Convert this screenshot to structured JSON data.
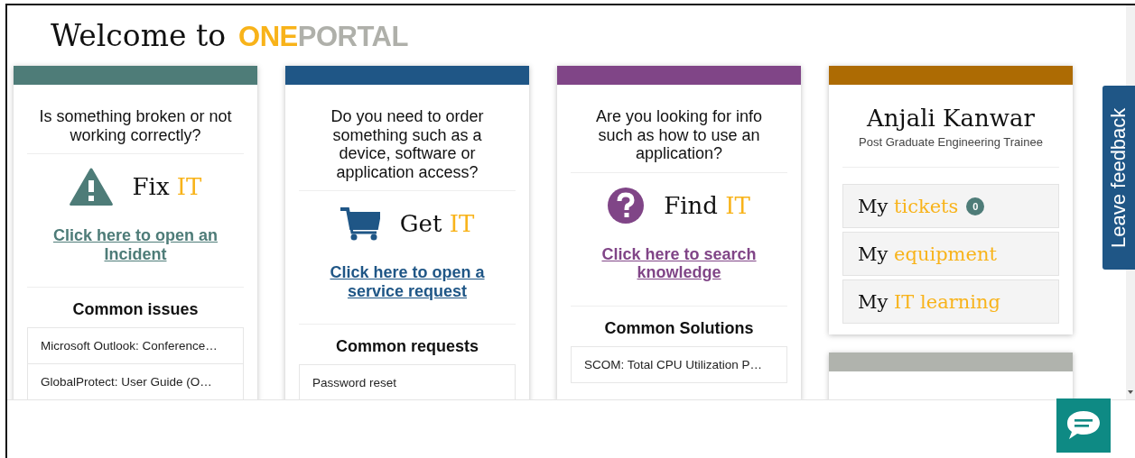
{
  "header": {
    "welcome": "Welcome to",
    "brand_primary": "ONE",
    "brand_secondary": "PORTAL"
  },
  "cards": [
    {
      "kind": "fix",
      "color": "#4e7c78",
      "question": "Is something broken or not working correctly?",
      "title": "Fix",
      "title_accent": "IT",
      "link": "Click here to open an Incident",
      "list_title": "Common issues",
      "items": [
        "Microsoft Outlook: Conference…",
        "GlobalProtect: User Guide (O…"
      ]
    },
    {
      "kind": "get",
      "color": "#1f5686",
      "question": "Do you need to order something such as a device, software or application access?",
      "title": "Get",
      "title_accent": "IT",
      "link": "Click here to open a service request",
      "list_title": "Common requests",
      "items": [
        "Password reset"
      ]
    },
    {
      "kind": "find",
      "color": "#804587",
      "question": "Are you looking for info such as how to use an application?",
      "title": "Find",
      "title_accent": "IT",
      "link": "Click here to search knowledge",
      "list_title": "Common Solutions",
      "items": [
        "SCOM: Total CPU Utilization P…"
      ]
    }
  ],
  "profile": {
    "color": "#ad6b03",
    "name": "Anjali Kanwar",
    "role": "Post Graduate Engineering Trainee",
    "links": [
      {
        "prefix": "My",
        "label": "tickets",
        "badge": "0"
      },
      {
        "prefix": "My",
        "label": "equipment"
      },
      {
        "prefix": "My",
        "label": "IT learning"
      }
    ]
  },
  "next_card": {
    "color": "#b0b3ad"
  },
  "feedback_tab": {
    "label": "Leave feedback"
  }
}
